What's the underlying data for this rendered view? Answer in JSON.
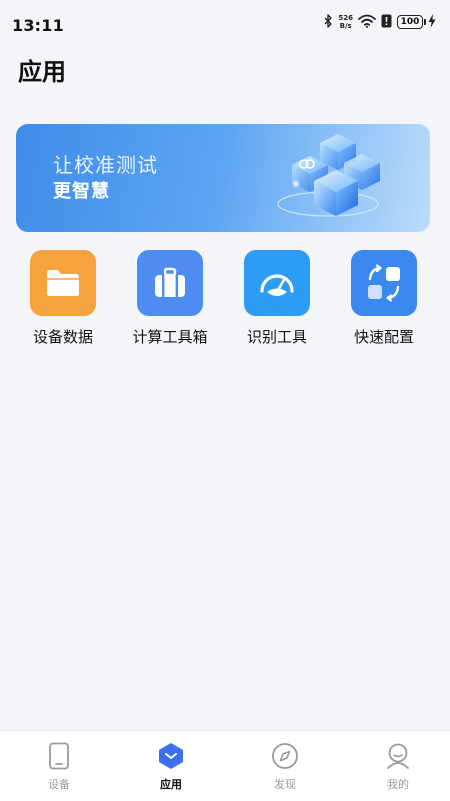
{
  "status_bar": {
    "time": "13:11",
    "net_speed_value": "526",
    "net_speed_unit": "B/s",
    "battery_level": "100"
  },
  "page": {
    "title": "应用"
  },
  "banner": {
    "line1": "让校准测试",
    "line2": "更智慧"
  },
  "apps": [
    {
      "label": "设备数据",
      "icon": "folder-icon",
      "color": "#f5a23f"
    },
    {
      "label": "计算工具箱",
      "icon": "toolbox-icon",
      "color": "#4f8cf2"
    },
    {
      "label": "识别工具",
      "icon": "gauge-icon",
      "color": "#2d9cf5"
    },
    {
      "label": "快速配置",
      "icon": "quick-config-icon",
      "color": "#3b88ef"
    }
  ],
  "bottom_nav": [
    {
      "label": "设备",
      "icon": "device-icon",
      "active": false
    },
    {
      "label": "应用",
      "icon": "apps-icon",
      "active": true
    },
    {
      "label": "发现",
      "icon": "compass-icon",
      "active": false
    },
    {
      "label": "我的",
      "icon": "profile-icon",
      "active": false
    }
  ],
  "colors": {
    "background": "#f4f5f9",
    "accent": "#3d6ef0",
    "inactive": "#9a9a9a"
  }
}
